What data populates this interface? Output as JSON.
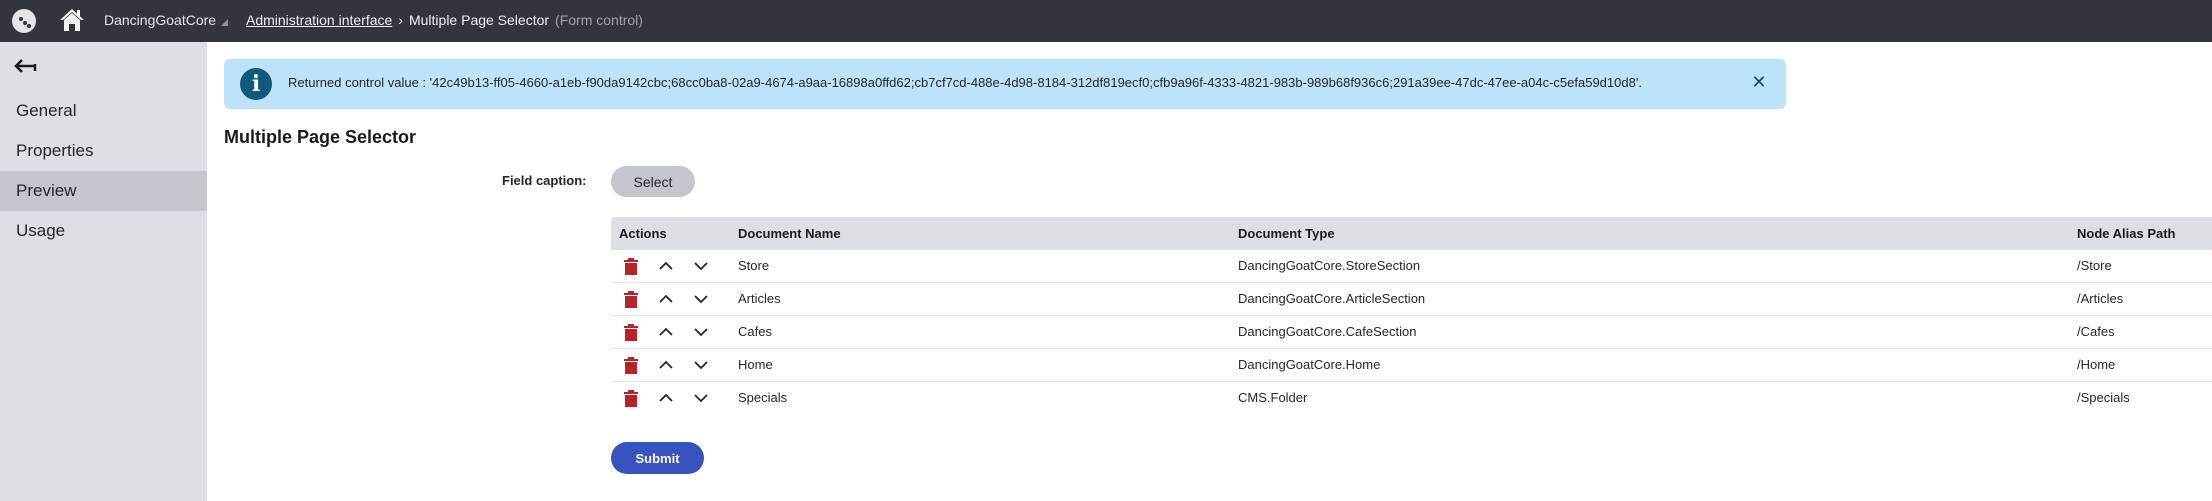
{
  "header": {
    "app_icon": "kentico-logo-icon",
    "home_icon": "home-icon",
    "site_name": "DancingGoatCore",
    "breadcrumb": {
      "link": "Administration interface",
      "separator": "›",
      "current": "Multiple Page Selector",
      "current_suffix": "(Form control)"
    }
  },
  "sidebar": {
    "back_icon": "back-arrow-icon",
    "items": [
      {
        "label": "General",
        "active": false
      },
      {
        "label": "Properties",
        "active": false
      },
      {
        "label": "Preview",
        "active": true
      },
      {
        "label": "Usage",
        "active": false
      }
    ]
  },
  "banner": {
    "icon": "info-icon",
    "icon_glyph": "i",
    "message": "Returned control value : '42c49b13-ff05-4660-a1eb-f90da9142cbc;68cc0ba8-02a9-4674-a9aa-16898a0ffd62;cb7cf7cd-488e-4d98-8184-312df819ecf0;cfb9a96f-4333-4821-983b-989b68f936c6;291a39ee-47dc-47ee-a04c-c5efa59d10d8'.",
    "close_glyph": "✕",
    "background": "#bde3fb"
  },
  "main": {
    "title": "Multiple Page Selector",
    "field_caption": "Field caption:",
    "select_label": "Select",
    "submit_label": "Submit",
    "grid": {
      "columns": [
        "Actions",
        "Document Name",
        "Document Type",
        "Node Alias Path"
      ],
      "rows": [
        {
          "name": "Store",
          "type": "DancingGoatCore.StoreSection",
          "path": "/Store"
        },
        {
          "name": "Articles",
          "type": "DancingGoatCore.ArticleSection",
          "path": "/Articles"
        },
        {
          "name": "Cafes",
          "type": "DancingGoatCore.CafeSection",
          "path": "/Cafes"
        },
        {
          "name": "Home",
          "type": "DancingGoatCore.Home",
          "path": "/Home"
        },
        {
          "name": "Specials",
          "type": "CMS.Folder",
          "path": "/Specials"
        }
      ]
    }
  },
  "colors": {
    "topbar": "#32353b",
    "sidebar": "#dcdfe4",
    "sidebar_active": "#c3c6cd",
    "delete": "#b2252b",
    "submit": "#3753be"
  }
}
